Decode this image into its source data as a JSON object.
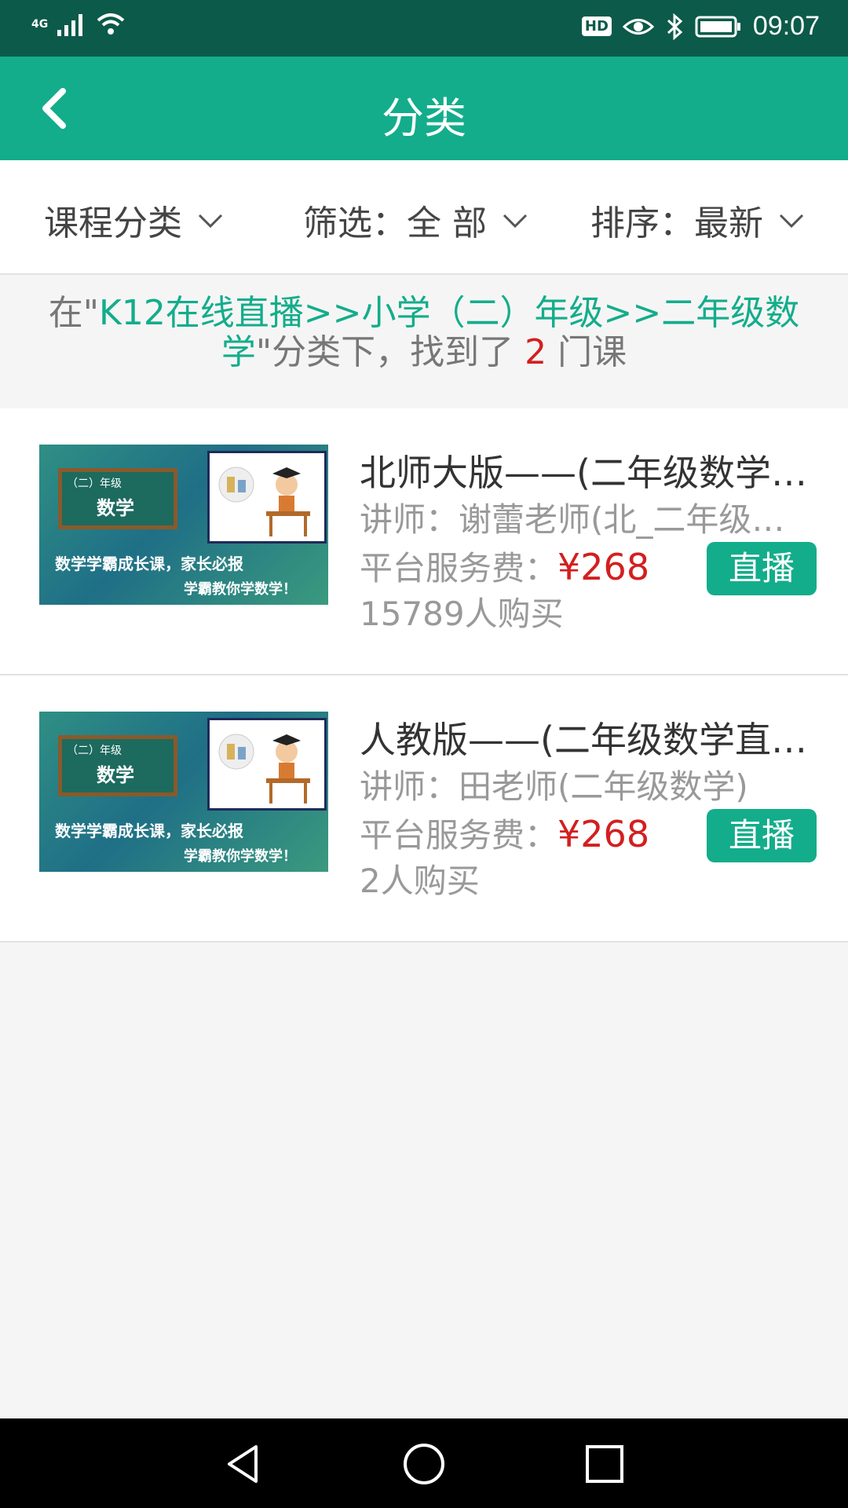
{
  "status_bar": {
    "network": "4G",
    "time": "09:07",
    "hd_badge": "HD",
    "icons": [
      "signal-icon",
      "wifi-icon",
      "hd-icon",
      "eye-comfort-icon",
      "bluetooth-icon",
      "battery-icon"
    ]
  },
  "app_bar": {
    "title": "分类",
    "back_icon": "back-arrow-icon"
  },
  "filters": {
    "category_label": "课程分类",
    "filter_label": "筛选：全 部",
    "sort_label": "排序：最新",
    "icon": "chevron-down-icon"
  },
  "result": {
    "prefix": "在\"",
    "path": "K12在线直播>>小学（二）年级>>二年级数学",
    "middle": "\"分类下，找到了",
    "count": "2",
    "suffix": "门课"
  },
  "courses": [
    {
      "title": "北师大版——(二年级数学…",
      "teacher": "讲师：谢蕾老师(北_二年级…",
      "fee_label": "平台服务费：",
      "price": "¥268",
      "buyers": "15789人购买",
      "badge": "直播",
      "thumb": {
        "grade": "（二）年级",
        "subject": "数学",
        "line1": "数学学霸成长课，家长必报",
        "line2": "学霸教你学数学！"
      }
    },
    {
      "title": "人教版——(二年级数学直…",
      "teacher": "讲师：田老师(二年级数学)",
      "fee_label": "平台服务费：",
      "price": "¥268",
      "buyers": "2人购买",
      "badge": "直播",
      "thumb": {
        "grade": "（二）年级",
        "subject": "数学",
        "line1": "数学学霸成长课，家长必报",
        "line2": "学霸教你学数学！"
      }
    }
  ],
  "nav_bar": {
    "icons": [
      "nav-back-icon",
      "nav-home-icon",
      "nav-recents-icon"
    ]
  },
  "colors": {
    "primary": "#13ad8b",
    "status_bar": "#0c5a49",
    "price_red": "#d31f1f"
  }
}
